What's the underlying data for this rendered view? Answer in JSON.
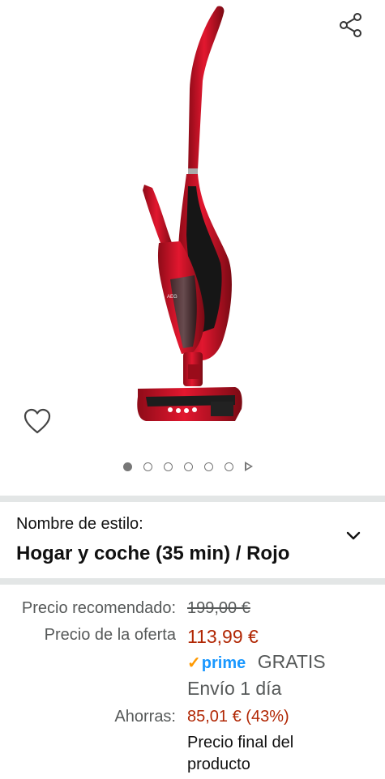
{
  "gallery": {
    "image_alt": "AEG cordless stick vacuum cleaner, red",
    "image_count": 6,
    "active_index": 0,
    "icons": {
      "share": "share-icon",
      "wishlist": "heart-icon",
      "video": "play-icon"
    }
  },
  "style": {
    "label": "Nombre de estilo:",
    "value": "Hogar y coche (35 min) / Rojo",
    "toggle_icon": "chevron-down-icon"
  },
  "pricing": {
    "rrp_label": "Precio recomendado:",
    "rrp_value": "199,00 €",
    "offer_label": "Precio de la oferta",
    "offer_value": "113,99 €",
    "prime_check": "✓",
    "prime_text": "prime",
    "shipping_label": "GRATIS",
    "delivery_text": "Envío 1 día",
    "savings_label": "Ahorras:",
    "savings_value": "85,01 € (43%)",
    "final_price_note": "Precio final del producto"
  },
  "colors": {
    "offer_price": "#B12704",
    "prime_blue": "#1a98ff",
    "prime_check": "#ff9900",
    "divider": "#e3e6e6",
    "product_red": "#c8102e"
  }
}
